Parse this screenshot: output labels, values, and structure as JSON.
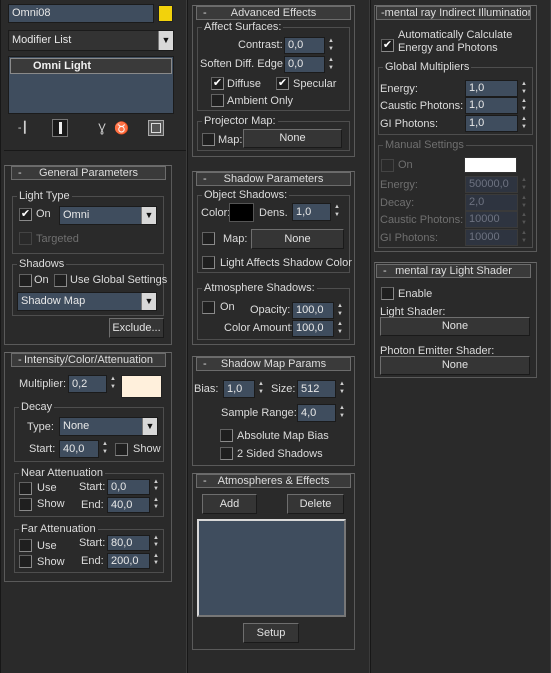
{
  "object": {
    "name": "Omni08",
    "color_swatch": "#f2d20c"
  },
  "modifier_list": {
    "label": "Modifier List"
  },
  "stack": {
    "items": [
      "Omni Light"
    ]
  },
  "toolbar": {
    "icons": [
      "pin-stack-icon",
      "show-end-result-icon",
      "make-unique-icon",
      "remove-modifier-icon",
      "configure-modifier-sets-icon"
    ]
  },
  "general": {
    "title": "General Parameters",
    "collapse": "-",
    "light_type": {
      "title": "Light Type",
      "on_label": "On",
      "on_checked": "✔",
      "type_value": "Omni",
      "targeted_label": "Targeted"
    },
    "shadows": {
      "title": "Shadows",
      "on_label": "On",
      "global_label": "Use Global Settings",
      "type_value": "Shadow Map",
      "exclude_label": "Exclude..."
    }
  },
  "intensity": {
    "title": "Intensity/Color/Attenuation",
    "collapse": "-",
    "multiplier_label": "Multiplier:",
    "multiplier_value": "0,2",
    "color": "#fff0dc",
    "decay": {
      "title": "Decay",
      "type_label": "Type:",
      "type_value": "None",
      "start_label": "Start:",
      "start_value": "40,0",
      "show_label": "Show"
    },
    "near": {
      "title": "Near Attenuation",
      "use_label": "Use",
      "show_label": "Show",
      "start_label": "Start:",
      "start_value": "0,0",
      "end_label": "End:",
      "end_value": "40,0"
    },
    "far": {
      "title": "Far Attenuation",
      "use_label": "Use",
      "show_label": "Show",
      "start_label": "Start:",
      "start_value": "80,0",
      "end_label": "End:",
      "end_value": "200,0"
    }
  },
  "advanced": {
    "title": "Advanced Effects",
    "collapse": "-",
    "affect_title": "Affect Surfaces:",
    "contrast_label": "Contrast:",
    "contrast_value": "0,0",
    "soften_label": "Soften Diff. Edge:",
    "soften_value": "0,0",
    "diffuse_label": "Diffuse",
    "diffuse_checked": "✔",
    "specular_label": "Specular",
    "specular_checked": "✔",
    "ambient_label": "Ambient Only",
    "projector_title": "Projector Map:",
    "map_label": "Map:",
    "map_button": "None"
  },
  "shadow_params": {
    "title": "Shadow Parameters",
    "collapse": "-",
    "object_title": "Object Shadows:",
    "color_label": "Color:",
    "color": "#000000",
    "dens_label": "Dens.",
    "dens_value": "1,0",
    "map_label": "Map:",
    "map_button": "None",
    "affects_label": "Light Affects Shadow Color",
    "atmo_title": "Atmosphere Shadows:",
    "on_label": "On",
    "opacity_label": "Opacity:",
    "opacity_value": "100,0",
    "amount_label": "Color Amount:",
    "amount_value": "100,0"
  },
  "shadow_map": {
    "title": "Shadow Map Params",
    "collapse": "-",
    "bias_label": "Bias:",
    "bias_value": "1,0",
    "size_label": "Size:",
    "size_value": "512",
    "range_label": "Sample Range:",
    "range_value": "4,0",
    "absolute_label": "Absolute Map Bias",
    "two_sided_label": "2 Sided Shadows"
  },
  "atmospheres": {
    "title": "Atmospheres & Effects",
    "collapse": "-",
    "add_label": "Add",
    "delete_label": "Delete",
    "setup_label": "Setup"
  },
  "indirect": {
    "title": "mental ray Indirect Illumination",
    "collapse": "-",
    "auto_label_1": "Automatically Calculate",
    "auto_label_2": "Energy and Photons",
    "auto_checked": "✔",
    "global_title": "Global Multipliers",
    "energy_label": "Energy:",
    "energy_value": "1,0",
    "caustic_label": "Caustic Photons:",
    "caustic_value": "1,0",
    "gi_label": "GI Photons:",
    "gi_value": "1,0",
    "manual_title": "Manual Settings",
    "on_label": "On",
    "manual_color": "#ffffff",
    "m_energy_label": "Energy:",
    "m_energy_value": "50000,0",
    "m_decay_label": "Decay:",
    "m_decay_value": "2,0",
    "m_caustic_label": "Caustic Photons:",
    "m_caustic_value": "10000",
    "m_gi_label": "GI Photons:",
    "m_gi_value": "10000"
  },
  "light_shader": {
    "title": "mental ray Light Shader",
    "collapse": "-",
    "enable_label": "Enable",
    "shader_label": "Light Shader:",
    "shader_button": "None",
    "photon_label": "Photon Emitter Shader:",
    "photon_button": "None"
  }
}
